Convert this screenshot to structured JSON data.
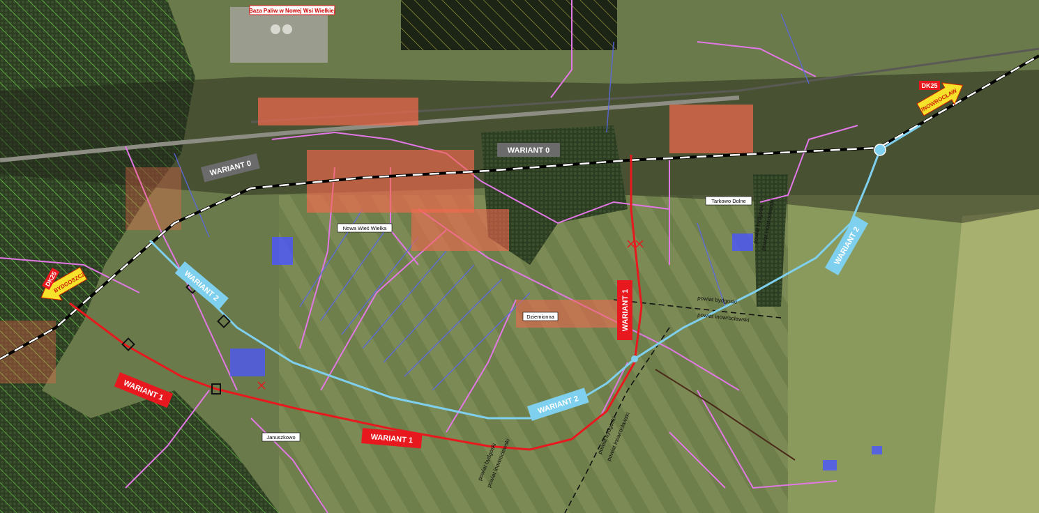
{
  "map": {
    "top_label": "Baza Paliw w Nowej Wsi Wielkiej",
    "variants": {
      "w0": "WARIANT 0",
      "w1": "WARIANT 1",
      "w2": "WARIANT 2"
    },
    "places": {
      "nowa_wies": "Nowa Wieś Wielka",
      "dziemionna": "Dziemionna",
      "tarkowo": "Tarkowo Dolne",
      "januszkowo": "Januszkowo"
    },
    "roads": {
      "dk25": "DK25",
      "bydgoszcz": "BYDGOSZCZ",
      "inowroclaw": "INOWROCŁAW"
    },
    "county": {
      "bydgoski": "powiat bydgoski",
      "inowroclawski": "powiat inowrocławski"
    },
    "colors": {
      "wariant_1": "#e8191e",
      "wariant_2": "#7fd0ef",
      "wariant_0": "#000000",
      "forest_hatch": "#6fe04a",
      "local_roads": "#e277e6",
      "buildings": "#f5684e"
    }
  }
}
